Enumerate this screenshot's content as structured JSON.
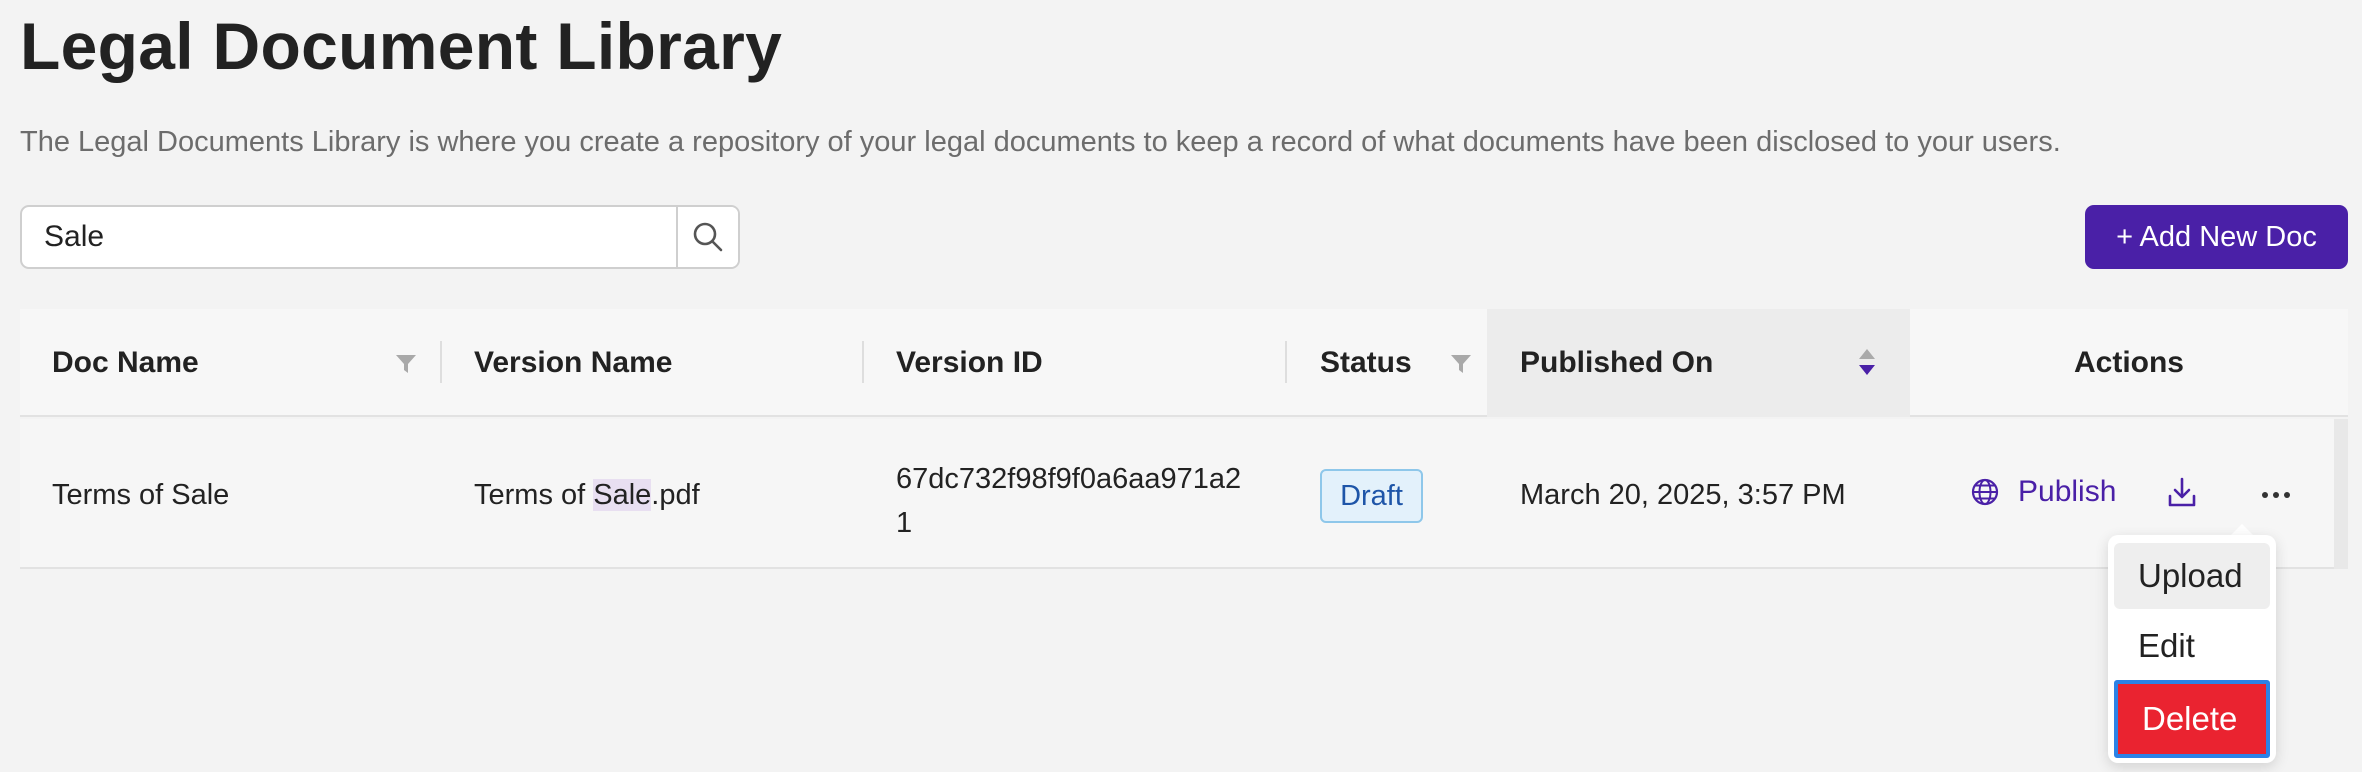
{
  "header": {
    "title": "Legal Document Library",
    "description": "The Legal Documents Library is where you create a repository of your legal documents to keep a record of what documents have been disclosed to your users."
  },
  "search": {
    "value": "Sale",
    "icon": "search-icon"
  },
  "toolbar": {
    "add_label": "+ Add New Doc"
  },
  "table": {
    "columns": [
      {
        "label": "Doc Name",
        "filter": true
      },
      {
        "label": "Version Name"
      },
      {
        "label": "Version ID"
      },
      {
        "label": "Status",
        "filter": true
      },
      {
        "label": "Published On",
        "sorted": true
      },
      {
        "label": "Actions"
      }
    ],
    "rows": [
      {
        "doc_name": "Terms of Sale",
        "version_name_prefix": "Terms of ",
        "version_name_match": "Sale",
        "version_name_suffix": ".pdf",
        "version_id_line1": "67dc732f98f9f0a6aa971a2",
        "version_id_line2": "1",
        "status": "Draft",
        "published_on": "March 20, 2025, 3:57 PM",
        "actions": {
          "publish_label": "Publish"
        }
      }
    ]
  },
  "menu": {
    "items": [
      "Upload",
      "Edit",
      "Delete"
    ]
  },
  "colors": {
    "accent": "#4a20a7",
    "delete": "#ea2330",
    "draft_badge_bg": "#e3f1fb",
    "draft_badge_text": "#1e55a8"
  }
}
